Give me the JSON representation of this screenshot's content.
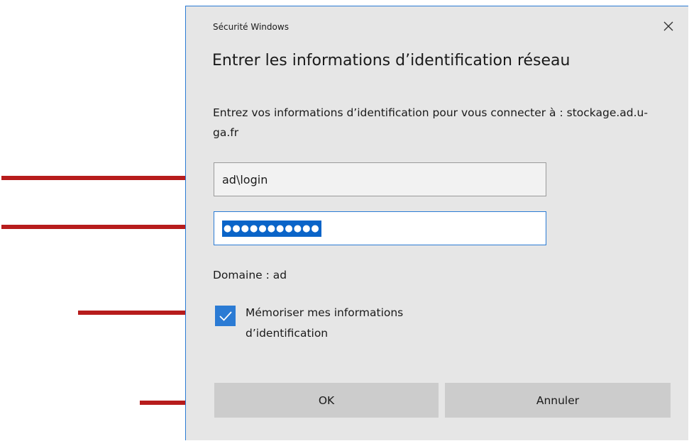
{
  "dialog": {
    "app_title": "Sécurité Windows",
    "heading": "Entrer les informations d’identification réseau",
    "message": "Entrez vos informations d’identification pour vous connecter à : stockage.ad.u-ga.fr",
    "username_value": "ad\\login",
    "password_mask": "●●●●●●●●●●●",
    "domain_label": "Domaine : ad",
    "remember_label": "Mémoriser mes informations d’identification",
    "remember_checked": true,
    "ok_label": "OK",
    "cancel_label": "Annuler"
  },
  "colors": {
    "accent": "#2b7bd4",
    "arrow": "#b71c1c",
    "dialog_bg": "#e6e6e6",
    "button_bg": "#cccccc"
  },
  "icons": {
    "close": "close-icon",
    "check": "checkmark-icon",
    "annotation": "arrow-right-icon"
  }
}
